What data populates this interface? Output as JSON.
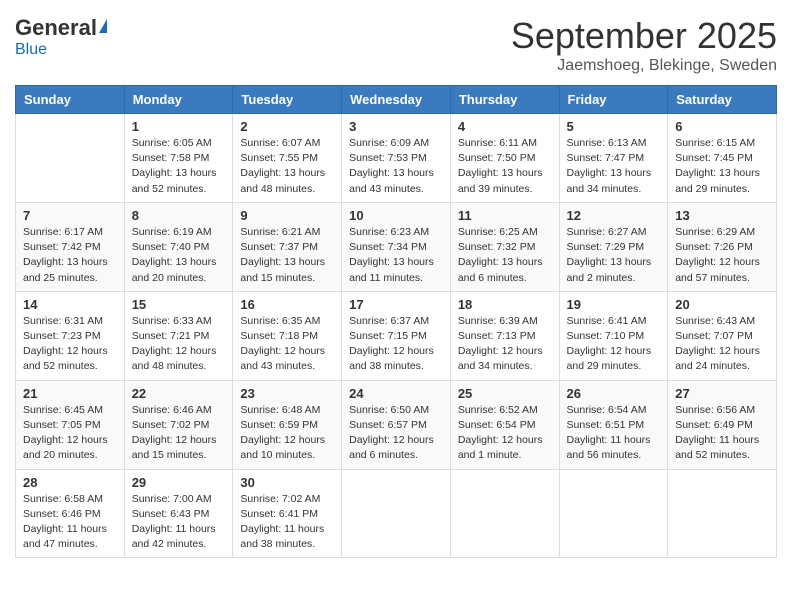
{
  "header": {
    "logo_general": "General",
    "logo_blue": "Blue",
    "month_title": "September 2025",
    "location": "Jaemshoeg, Blekinge, Sweden"
  },
  "weekdays": [
    "Sunday",
    "Monday",
    "Tuesday",
    "Wednesday",
    "Thursday",
    "Friday",
    "Saturday"
  ],
  "weeks": [
    [
      {
        "day": "",
        "info": ""
      },
      {
        "day": "1",
        "info": "Sunrise: 6:05 AM\nSunset: 7:58 PM\nDaylight: 13 hours\nand 52 minutes."
      },
      {
        "day": "2",
        "info": "Sunrise: 6:07 AM\nSunset: 7:55 PM\nDaylight: 13 hours\nand 48 minutes."
      },
      {
        "day": "3",
        "info": "Sunrise: 6:09 AM\nSunset: 7:53 PM\nDaylight: 13 hours\nand 43 minutes."
      },
      {
        "day": "4",
        "info": "Sunrise: 6:11 AM\nSunset: 7:50 PM\nDaylight: 13 hours\nand 39 minutes."
      },
      {
        "day": "5",
        "info": "Sunrise: 6:13 AM\nSunset: 7:47 PM\nDaylight: 13 hours\nand 34 minutes."
      },
      {
        "day": "6",
        "info": "Sunrise: 6:15 AM\nSunset: 7:45 PM\nDaylight: 13 hours\nand 29 minutes."
      }
    ],
    [
      {
        "day": "7",
        "info": "Sunrise: 6:17 AM\nSunset: 7:42 PM\nDaylight: 13 hours\nand 25 minutes."
      },
      {
        "day": "8",
        "info": "Sunrise: 6:19 AM\nSunset: 7:40 PM\nDaylight: 13 hours\nand 20 minutes."
      },
      {
        "day": "9",
        "info": "Sunrise: 6:21 AM\nSunset: 7:37 PM\nDaylight: 13 hours\nand 15 minutes."
      },
      {
        "day": "10",
        "info": "Sunrise: 6:23 AM\nSunset: 7:34 PM\nDaylight: 13 hours\nand 11 minutes."
      },
      {
        "day": "11",
        "info": "Sunrise: 6:25 AM\nSunset: 7:32 PM\nDaylight: 13 hours\nand 6 minutes."
      },
      {
        "day": "12",
        "info": "Sunrise: 6:27 AM\nSunset: 7:29 PM\nDaylight: 13 hours\nand 2 minutes."
      },
      {
        "day": "13",
        "info": "Sunrise: 6:29 AM\nSunset: 7:26 PM\nDaylight: 12 hours\nand 57 minutes."
      }
    ],
    [
      {
        "day": "14",
        "info": "Sunrise: 6:31 AM\nSunset: 7:23 PM\nDaylight: 12 hours\nand 52 minutes."
      },
      {
        "day": "15",
        "info": "Sunrise: 6:33 AM\nSunset: 7:21 PM\nDaylight: 12 hours\nand 48 minutes."
      },
      {
        "day": "16",
        "info": "Sunrise: 6:35 AM\nSunset: 7:18 PM\nDaylight: 12 hours\nand 43 minutes."
      },
      {
        "day": "17",
        "info": "Sunrise: 6:37 AM\nSunset: 7:15 PM\nDaylight: 12 hours\nand 38 minutes."
      },
      {
        "day": "18",
        "info": "Sunrise: 6:39 AM\nSunset: 7:13 PM\nDaylight: 12 hours\nand 34 minutes."
      },
      {
        "day": "19",
        "info": "Sunrise: 6:41 AM\nSunset: 7:10 PM\nDaylight: 12 hours\nand 29 minutes."
      },
      {
        "day": "20",
        "info": "Sunrise: 6:43 AM\nSunset: 7:07 PM\nDaylight: 12 hours\nand 24 minutes."
      }
    ],
    [
      {
        "day": "21",
        "info": "Sunrise: 6:45 AM\nSunset: 7:05 PM\nDaylight: 12 hours\nand 20 minutes."
      },
      {
        "day": "22",
        "info": "Sunrise: 6:46 AM\nSunset: 7:02 PM\nDaylight: 12 hours\nand 15 minutes."
      },
      {
        "day": "23",
        "info": "Sunrise: 6:48 AM\nSunset: 6:59 PM\nDaylight: 12 hours\nand 10 minutes."
      },
      {
        "day": "24",
        "info": "Sunrise: 6:50 AM\nSunset: 6:57 PM\nDaylight: 12 hours\nand 6 minutes."
      },
      {
        "day": "25",
        "info": "Sunrise: 6:52 AM\nSunset: 6:54 PM\nDaylight: 12 hours\nand 1 minute."
      },
      {
        "day": "26",
        "info": "Sunrise: 6:54 AM\nSunset: 6:51 PM\nDaylight: 11 hours\nand 56 minutes."
      },
      {
        "day": "27",
        "info": "Sunrise: 6:56 AM\nSunset: 6:49 PM\nDaylight: 11 hours\nand 52 minutes."
      }
    ],
    [
      {
        "day": "28",
        "info": "Sunrise: 6:58 AM\nSunset: 6:46 PM\nDaylight: 11 hours\nand 47 minutes."
      },
      {
        "day": "29",
        "info": "Sunrise: 7:00 AM\nSunset: 6:43 PM\nDaylight: 11 hours\nand 42 minutes."
      },
      {
        "day": "30",
        "info": "Sunrise: 7:02 AM\nSunset: 6:41 PM\nDaylight: 11 hours\nand 38 minutes."
      },
      {
        "day": "",
        "info": ""
      },
      {
        "day": "",
        "info": ""
      },
      {
        "day": "",
        "info": ""
      },
      {
        "day": "",
        "info": ""
      }
    ]
  ]
}
